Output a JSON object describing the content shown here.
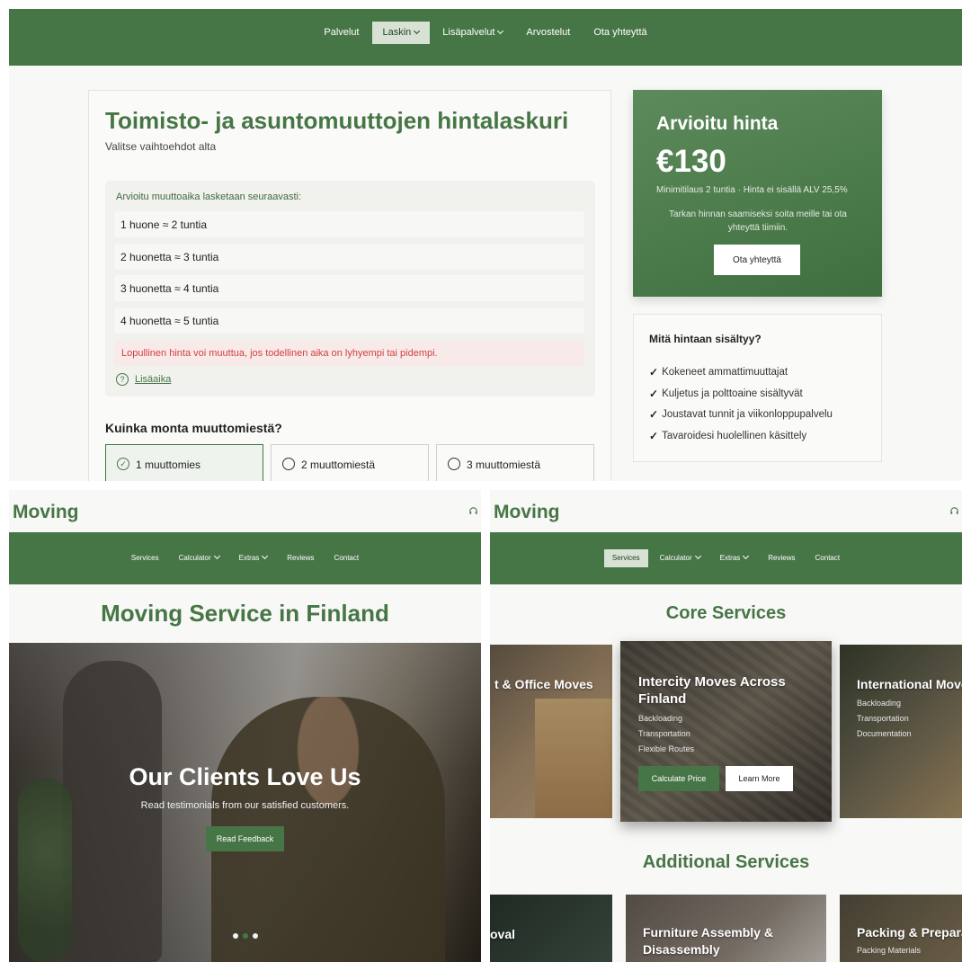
{
  "calc": {
    "nav": [
      {
        "label": "Palvelut",
        "active": false,
        "dropdown": false
      },
      {
        "label": "Laskin",
        "active": true,
        "dropdown": true
      },
      {
        "label": "Lisäpalvelut",
        "active": false,
        "dropdown": true
      },
      {
        "label": "Arvostelut",
        "active": false,
        "dropdown": false
      },
      {
        "label": "Ota yhteyttä",
        "active": false,
        "dropdown": false
      }
    ],
    "title": "Toimisto- ja asuntomuuttojen hintalaskuri",
    "subtitle": "Valitse vaihtoehdot alta",
    "info_heading": "Arvioitu muuttoaika lasketaan seuraavasti:",
    "rooms": [
      "1 huone ≈ 2 tuntia",
      "2 huonetta ≈ 3 tuntia",
      "3 huonetta ≈ 4 tuntia",
      "4 huonetta ≈ 5 tuntia"
    ],
    "warning": "Lopullinen hinta voi muuttua, jos todellinen aika on lyhyempi tai pidempi.",
    "extra_link": "Lisäaika",
    "movers_question": "Kuinka monta muuttomiestä?",
    "mover_options": [
      {
        "label": "1 muuttomies",
        "selected": true
      },
      {
        "label": "2 muuttomiestä",
        "selected": false
      },
      {
        "label": "3 muuttomiestä",
        "selected": false
      }
    ],
    "price": {
      "title": "Arvioitu hinta",
      "value": "€130",
      "note": "Minimitilaus 2 tuntia · Hinta ei sisällä ALV 25,5%",
      "contact_text": "Tarkan hinnan saamiseksi soita meille tai ota yhteyttä tiimiin.",
      "button": "Ota yhteyttä"
    },
    "included": {
      "title": "Mitä hintaan sisältyy?",
      "items": [
        "Kokeneet ammattimuuttajat",
        "Kuljetus ja polttoaine sisältyvät",
        "Joustavat tunnit ja viikonloppupalvelu",
        "Tavaroidesi huolellinen käsittely"
      ]
    }
  },
  "home": {
    "logo": "Moving",
    "nav": [
      {
        "label": "Services",
        "active": false,
        "dropdown": false
      },
      {
        "label": "Calculator",
        "active": false,
        "dropdown": true
      },
      {
        "label": "Extras",
        "active": false,
        "dropdown": true
      },
      {
        "label": "Reviews",
        "active": false,
        "dropdown": false
      },
      {
        "label": "Contact",
        "active": false,
        "dropdown": false
      }
    ],
    "heading": "Moving Service in Finland",
    "hero_title": "Our Clients Love Us",
    "hero_text": "Read testimonials from our satisfied customers.",
    "hero_button": "Read Feedback",
    "slide_index": 2,
    "slide_count": 3
  },
  "services": {
    "logo": "Moving",
    "nav": [
      {
        "label": "Services",
        "active": true,
        "dropdown": false
      },
      {
        "label": "Calculator",
        "active": false,
        "dropdown": true
      },
      {
        "label": "Extras",
        "active": false,
        "dropdown": true
      },
      {
        "label": "Reviews",
        "active": false,
        "dropdown": false
      },
      {
        "label": "Contact",
        "active": false,
        "dropdown": false
      }
    ],
    "core_heading": "Core Services",
    "cards": [
      {
        "title": "t & Office Moves",
        "items": []
      },
      {
        "title": "Intercity Moves Across Finland",
        "items": [
          "Backloading",
          "Transportation",
          "Flexible Routes"
        ],
        "primary_button": "Calculate Price",
        "secondary_button": "Learn More"
      },
      {
        "title": "International Move",
        "items": [
          "Backloading",
          "Transportation",
          "Documentation"
        ]
      }
    ],
    "additional_heading": "Additional Services",
    "add_cards": [
      {
        "title": "oval",
        "items": []
      },
      {
        "title": "Furniture Assembly & Disassembly",
        "items": []
      },
      {
        "title": "Packing & Prepara",
        "items": [
          "Packing Materials"
        ]
      }
    ]
  },
  "colors": {
    "brand": "#477646",
    "active_nav": "#d7e2d5",
    "warning": "#d23f3f",
    "warning_bg": "#f9eaea"
  }
}
